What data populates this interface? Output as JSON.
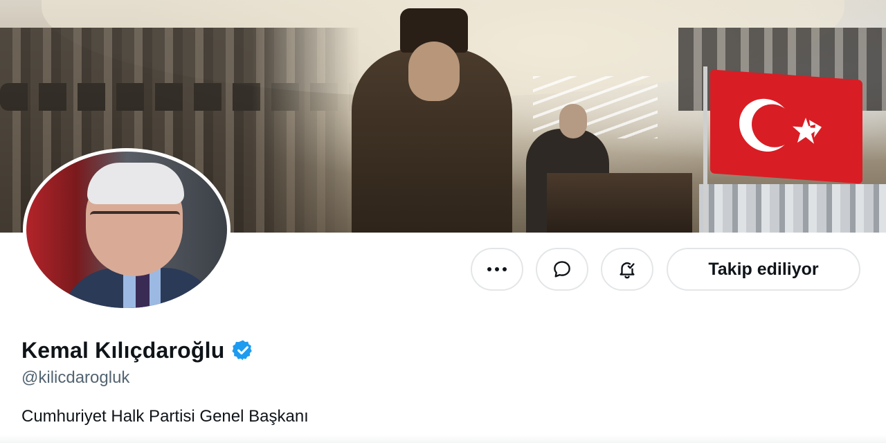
{
  "profile": {
    "display_name": "Kemal Kılıçdaroğlu",
    "handle": "@kilicdarogluk",
    "bio": "Cumhuriyet Halk Partisi Genel Başkanı",
    "verified": true
  },
  "actions": {
    "more_icon": "more-horizontal-icon",
    "message_icon": "message-icon",
    "notify_icon": "bell-check-icon",
    "follow_label": "Takip ediliyor"
  },
  "colors": {
    "text_primary": "#0f1419",
    "text_secondary": "#536471",
    "verified_blue": "#1d9bf0",
    "button_border": "#e3e6e8",
    "flag_red": "#d91d24"
  }
}
